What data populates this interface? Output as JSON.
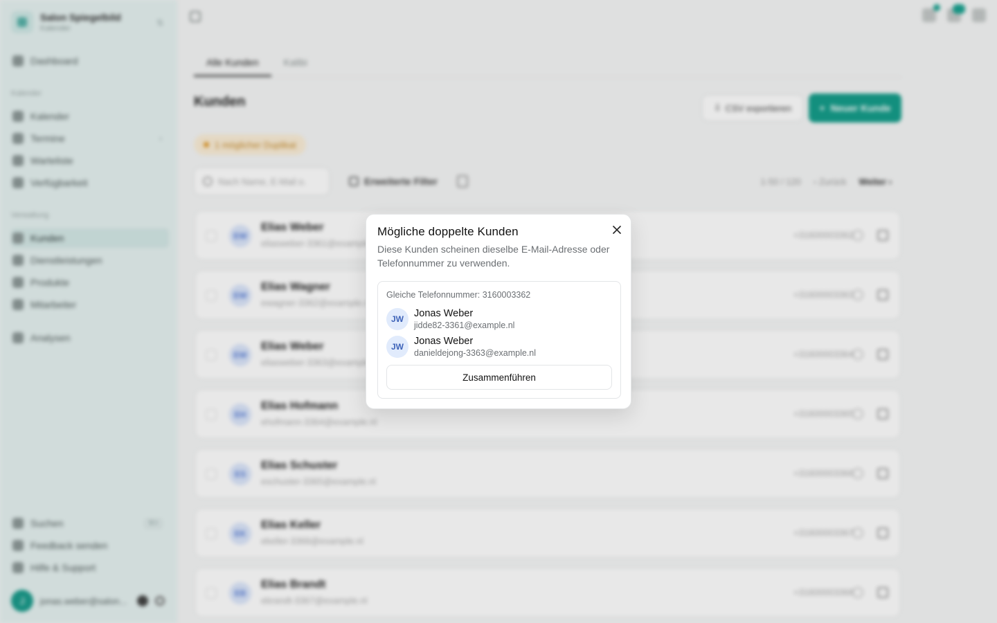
{
  "sidebar": {
    "brand_name": "Salon Spiegelbild",
    "brand_sub": "Kalender",
    "items": [
      {
        "label": "Dashboard"
      },
      {
        "label": "Kalender"
      },
      {
        "label": "Termine"
      },
      {
        "label": "Warteliste"
      },
      {
        "label": "Verfügbarkeit"
      },
      {
        "label": "Kunden"
      },
      {
        "label": "Dienstleistungen"
      },
      {
        "label": "Produkte"
      },
      {
        "label": "Mitarbeiter"
      },
      {
        "label": "Analysen"
      }
    ],
    "groups": {
      "calendar": "Kalender",
      "admin": "Verwaltung"
    },
    "footer": [
      {
        "label": "Suchen",
        "shortcut": "⌘K"
      },
      {
        "label": "Feedback senden"
      },
      {
        "label": "Hilfe & Support"
      }
    ],
    "user": {
      "initial": "J",
      "name": "jonas.weber@salon..."
    }
  },
  "tabs": [
    {
      "label": "Alle Kunden"
    },
    {
      "label": "Kalibi"
    }
  ],
  "page": {
    "title": "Kunden",
    "export_label": "CSV exportieren",
    "new_label": "Neuer Kunde",
    "duplicates_pill": "1 möglicher Duplikat",
    "search_placeholder": "Nach Name, E-Mail o.",
    "advanced_filter_label": "Erweiterte Filter",
    "pager_range": "1-50 / 120",
    "pager_prev": "Zurück",
    "pager_next": "Weiter"
  },
  "rows": [
    {
      "initials": "EW",
      "name": "Elias Weber",
      "email": "eliasweber-3361@example.nl",
      "phone": "+31600003362"
    },
    {
      "initials": "EW",
      "name": "Elias Wagner",
      "email": "ewagner-3362@example.nl",
      "phone": "+31600003363"
    },
    {
      "initials": "EW",
      "name": "Elias Weber",
      "email": "eliasweber-3363@example.nl",
      "phone": "+31600003364"
    },
    {
      "initials": "EH",
      "name": "Elias Hofmann",
      "email": "ehofmann-3364@example.nl",
      "phone": "+31600003365"
    },
    {
      "initials": "ES",
      "name": "Elias Schuster",
      "email": "eschuster-3365@example.nl",
      "phone": "+31600003366"
    },
    {
      "initials": "EK",
      "name": "Elias Keller",
      "email": "ekeller-3366@example.nl",
      "phone": "+31600003367"
    },
    {
      "initials": "EB",
      "name": "Elias Brandt",
      "email": "ebrandt-3367@example.nl",
      "phone": "+31600003368"
    }
  ],
  "modal": {
    "title": "Mögliche doppelte Kunden",
    "description": "Diese Kunden scheinen dieselbe E-Mail-Adresse oder Telefonnummer zu verwenden.",
    "close_icon": "close-icon",
    "group": {
      "title": "Gleiche Telefonnummer: 3160003362",
      "customers": [
        {
          "initials": "JW",
          "name": "Jonas Weber",
          "email": "jidde82-3361@example.nl"
        },
        {
          "initials": "JW",
          "name": "Jonas Weber",
          "email": "danieldejong-3363@example.nl"
        }
      ],
      "merge_label": "Zusammenführen"
    }
  },
  "colors": {
    "accent": "#159e8b",
    "sidebar_bg": "#e6f2f1",
    "avatar_bg": "#e1ebfc",
    "avatar_text": "#3e63b8"
  }
}
